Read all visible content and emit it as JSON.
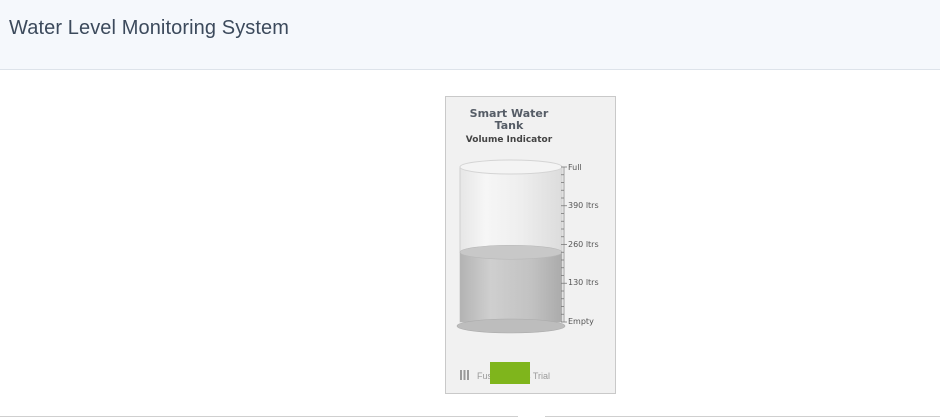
{
  "header": {
    "title": "Water Level Monitoring System"
  },
  "widget": {
    "caption": [
      "Smart Water",
      "Tank"
    ],
    "subcaption": "Volume Indicator",
    "level_fraction": 0.45,
    "scale_labels": [
      "Full",
      "390 ltrs",
      "260 ltrs",
      "130 ltrs",
      "Empty"
    ],
    "trial_text": "FusionCharts Trial"
  },
  "colors": {
    "header_bg": "#f5f8fc",
    "water": "#b9b9b9",
    "badge": "#7fb51c"
  }
}
